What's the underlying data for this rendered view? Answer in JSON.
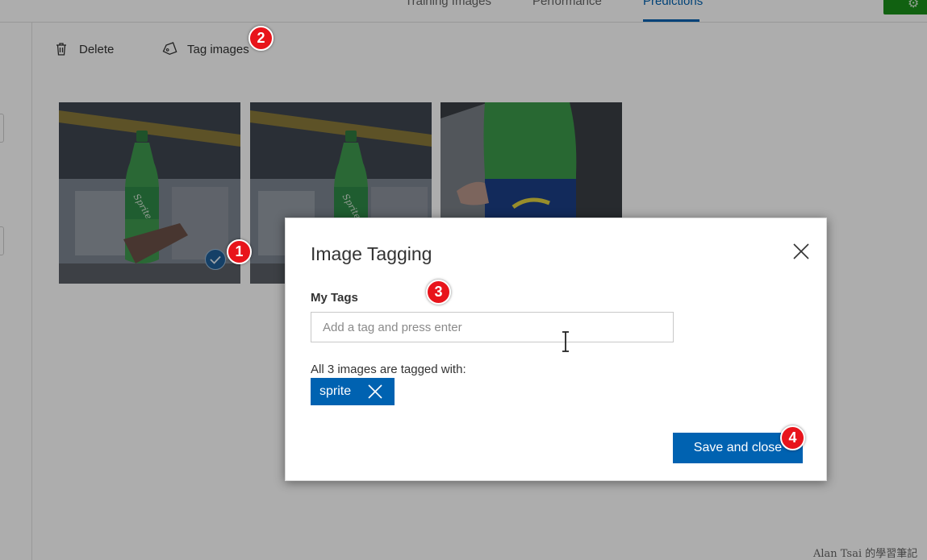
{
  "nav": {
    "tabs": [
      {
        "label": "Training Images"
      },
      {
        "label": "Performance"
      },
      {
        "label": "Predictions",
        "active": true
      }
    ]
  },
  "toolbar": {
    "delete_label": "Delete",
    "tag_images_label": "Tag images"
  },
  "images": [
    {
      "selected": true
    },
    {
      "selected": false
    },
    {
      "selected": false
    }
  ],
  "modal": {
    "title": "Image Tagging",
    "tags_label": "My Tags",
    "tag_input": {
      "value": "",
      "placeholder": "Add a tag and press enter"
    },
    "tagged_with_text": "All 3 images are tagged with:",
    "tags": [
      {
        "label": "sprite"
      }
    ],
    "save_label": "Save and close"
  },
  "callouts": [
    "1",
    "2",
    "3",
    "4"
  ],
  "watermark": "Alan Tsai 的學習筆記",
  "colors": {
    "accent": "#0062b1",
    "callout": "#e8141b",
    "run_button": "#1a8f1a"
  }
}
